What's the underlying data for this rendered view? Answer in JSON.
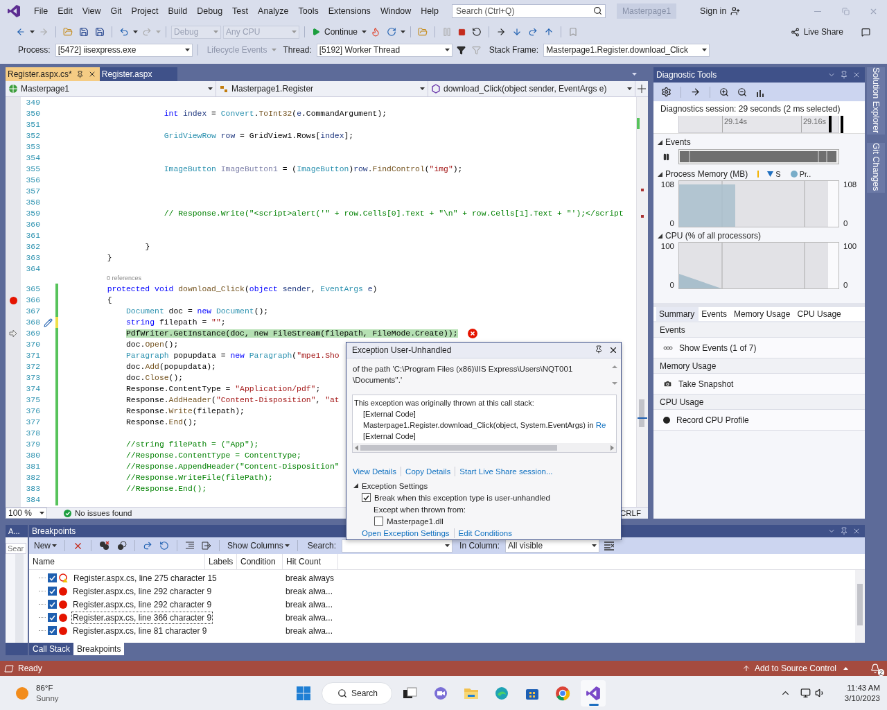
{
  "menu": {
    "items": [
      "File",
      "Edit",
      "View",
      "Git",
      "Project",
      "Build",
      "Debug",
      "Test",
      "Analyze",
      "Tools",
      "Extensions",
      "Window",
      "Help"
    ],
    "search": {
      "placeholder": "Search (Ctrl+Q)"
    },
    "solution": "Masterpage1",
    "sign_in": "Sign in"
  },
  "toolbar": {
    "configuration": {
      "value": "Debug",
      "disabled": true
    },
    "platform": {
      "value": "Any CPU",
      "disabled": true
    },
    "continue": "Continue",
    "live_share": "Live Share"
  },
  "debug_location": {
    "process_label": "Process:",
    "process": "[5472] iisexpress.exe",
    "lifecycle": {
      "label": "Lifecycle Events",
      "disabled": true
    },
    "thread_label": "Thread:",
    "thread": "[5192] Worker Thread",
    "stack_frame_label": "Stack Frame:",
    "stack_frame": "Masterpage1.Register.download_Click"
  },
  "editor": {
    "tabs": [
      {
        "label": "Register.aspx.cs*",
        "selected": true
      },
      {
        "label": "Register.aspx",
        "selected": false
      }
    ],
    "nav": [
      "Masterpage1",
      "Masterpage1.Register",
      "download_Click(object sender, EventArgs e)"
    ],
    "lines": [
      {
        "number": "349"
      },
      {
        "number": "350",
        "segments": [
          {
            "kind": "keyword",
            "text": "                    int"
          },
          {
            "kind": "local",
            "text": " index"
          },
          {
            "kind": "plain",
            "text": " = "
          },
          {
            "kind": "type",
            "text": "Convert"
          },
          {
            "kind": "plain",
            "text": "."
          },
          {
            "kind": "method",
            "text": "ToInt32"
          },
          {
            "kind": "plain",
            "text": "("
          },
          {
            "kind": "local",
            "text": "e"
          },
          {
            "kind": "plain",
            "text": ".CommandArgument);"
          }
        ]
      },
      {
        "number": "351"
      },
      {
        "number": "352",
        "segments": [
          {
            "kind": "type",
            "text": "                    GridViewRow"
          },
          {
            "kind": "local",
            "text": " row"
          },
          {
            "kind": "plain",
            "text": " = GridView1.Rows["
          },
          {
            "kind": "local",
            "text": "index"
          },
          {
            "kind": "plain",
            "text": "];"
          }
        ]
      },
      {
        "number": "353"
      },
      {
        "number": "354"
      },
      {
        "number": "355",
        "segments": [
          {
            "kind": "type",
            "text": "                    ImageButton"
          },
          {
            "kind": "unused",
            "text": " ImageButton1"
          },
          {
            "kind": "plain",
            "text": " = ("
          },
          {
            "kind": "type",
            "text": "ImageButton"
          },
          {
            "kind": "plain",
            "text": ")"
          },
          {
            "kind": "local",
            "text": "row"
          },
          {
            "kind": "plain",
            "text": "."
          },
          {
            "kind": "method",
            "text": "FindControl"
          },
          {
            "kind": "plain",
            "text": "("
          },
          {
            "kind": "string",
            "text": "\"img\""
          },
          {
            "kind": "plain",
            "text": ");"
          }
        ]
      },
      {
        "number": "356"
      },
      {
        "number": "357"
      },
      {
        "number": "358"
      },
      {
        "number": "359",
        "segments": [
          {
            "kind": "comment",
            "text": "                    // Response.Write(\"<script>alert('\" + row.Cells[0].Text + \"\\n\" + row.Cells[1].Text + \"');</script"
          }
        ]
      },
      {
        "number": "360"
      },
      {
        "number": "361"
      },
      {
        "number": "362",
        "segments": [
          {
            "kind": "plain",
            "text": "                }"
          }
        ]
      },
      {
        "number": "363",
        "segments": [
          {
            "kind": "plain",
            "text": "        }"
          }
        ]
      },
      {
        "number": "364"
      },
      {
        "number": "365",
        "codelens": "0 references",
        "changed": true,
        "segments": [
          {
            "kind": "keyword",
            "text": "        protected"
          },
          {
            "kind": "keyword",
            "text": " void"
          },
          {
            "kind": "method",
            "text": " download_Click"
          },
          {
            "kind": "plain",
            "text": "("
          },
          {
            "kind": "keyword",
            "text": "object"
          },
          {
            "kind": "local",
            "text": " sender"
          },
          {
            "kind": "plain",
            "text": ", "
          },
          {
            "kind": "type",
            "text": "EventArgs"
          },
          {
            "kind": "local",
            "text": " e"
          },
          {
            "kind": "plain",
            "text": ")"
          }
        ]
      },
      {
        "number": "366",
        "breakpoint": true,
        "changed": true,
        "segments": [
          {
            "kind": "plain",
            "text": "        {"
          }
        ]
      },
      {
        "number": "367",
        "changed": true,
        "segments": [
          {
            "kind": "type",
            "text": "            Document"
          },
          {
            "kind": "plain",
            "text": " doc = "
          },
          {
            "kind": "keyword",
            "text": "new"
          },
          {
            "kind": "type",
            "text": " Document"
          },
          {
            "kind": "plain",
            "text": "();"
          }
        ]
      },
      {
        "number": "368",
        "edited": true,
        "changed": true,
        "unsaved": true,
        "segments": [
          {
            "kind": "keyword",
            "text": "            string"
          },
          {
            "kind": "plain",
            "text": " filepath = "
          },
          {
            "kind": "string",
            "text": "\"\""
          },
          {
            "kind": "plain",
            "text": ";"
          }
        ]
      },
      {
        "number": "369",
        "current": true,
        "changed": true,
        "segments": [
          {
            "kind": "plain",
            "text": "            PdfWriter.GetInstance(doc, new FileStream(filepath, FileMode.Create));"
          }
        ]
      },
      {
        "number": "370",
        "changed": true,
        "segments": [
          {
            "kind": "plain",
            "text": "            doc."
          },
          {
            "kind": "method",
            "text": "Open"
          },
          {
            "kind": "plain",
            "text": "();"
          }
        ]
      },
      {
        "number": "371",
        "changed": true,
        "segments": [
          {
            "kind": "type",
            "text": "            Paragraph"
          },
          {
            "kind": "plain",
            "text": " popupdata = "
          },
          {
            "kind": "keyword",
            "text": "new"
          },
          {
            "kind": "type",
            "text": " Paragraph"
          },
          {
            "kind": "plain",
            "text": "("
          },
          {
            "kind": "string",
            "text": "\"mpe1.Sho"
          }
        ]
      },
      {
        "number": "372",
        "changed": true,
        "segments": [
          {
            "kind": "plain",
            "text": "            doc."
          },
          {
            "kind": "method",
            "text": "Add"
          },
          {
            "kind": "plain",
            "text": "(popupdata);"
          }
        ]
      },
      {
        "number": "373",
        "changed": true,
        "segments": [
          {
            "kind": "plain",
            "text": "            doc."
          },
          {
            "kind": "method",
            "text": "Close"
          },
          {
            "kind": "plain",
            "text": "();"
          }
        ]
      },
      {
        "number": "374",
        "changed": true,
        "segments": [
          {
            "kind": "plain",
            "text": "            Response.ContentType = "
          },
          {
            "kind": "string",
            "text": "\"Application/pdf\""
          },
          {
            "kind": "plain",
            "text": ";"
          }
        ]
      },
      {
        "number": "375",
        "changed": true,
        "segments": [
          {
            "kind": "plain",
            "text": "            Response."
          },
          {
            "kind": "method",
            "text": "AddHeader"
          },
          {
            "kind": "plain",
            "text": "("
          },
          {
            "kind": "string",
            "text": "\"Content-Disposition\""
          },
          {
            "kind": "plain",
            "text": ", "
          },
          {
            "kind": "string",
            "text": "\"at"
          }
        ]
      },
      {
        "number": "376",
        "changed": true,
        "segments": [
          {
            "kind": "plain",
            "text": "            Response."
          },
          {
            "kind": "method",
            "text": "Write"
          },
          {
            "kind": "plain",
            "text": "(filepath);"
          }
        ]
      },
      {
        "number": "377",
        "changed": true,
        "segments": [
          {
            "kind": "plain",
            "text": "            Response."
          },
          {
            "kind": "method",
            "text": "End"
          },
          {
            "kind": "plain",
            "text": "();"
          }
        ]
      },
      {
        "number": "378",
        "changed": true
      },
      {
        "number": "379",
        "changed": true,
        "segments": [
          {
            "kind": "comment",
            "text": "            //string filePath = (\"App\");"
          }
        ]
      },
      {
        "number": "380",
        "changed": true,
        "segments": [
          {
            "kind": "comment",
            "text": "            //Response.ContentType = ContentType;"
          }
        ]
      },
      {
        "number": "381",
        "changed": true,
        "segments": [
          {
            "kind": "comment",
            "text": "            //Response.AppendHeader(\"Content-Disposition\""
          }
        ]
      },
      {
        "number": "382",
        "changed": true,
        "segments": [
          {
            "kind": "comment",
            "text": "            //Response.WriteFile(filePath);"
          }
        ]
      },
      {
        "number": "383",
        "changed": true,
        "segments": [
          {
            "kind": "comment",
            "text": "            //Response.End();"
          }
        ]
      },
      {
        "number": "384",
        "changed": true
      }
    ],
    "zoom": "100 %",
    "issues": "No issues found",
    "line_ending": "CRLF"
  },
  "exception": {
    "title": "Exception User-Unhandled",
    "message": [
      "of the path 'C:\\Program Files (x86)\\IIS Express\\Users\\NQT001",
      "\\Documents''.'"
    ],
    "stack_intro": "This exception was originally thrown at this call stack:",
    "stack": [
      {
        "text": "[External Code]"
      },
      {
        "text": "Masterpage1.Register.download_Click(object, System.EventArgs) in ",
        "link": "Re"
      },
      {
        "text": "[External Code]"
      }
    ],
    "links": [
      "View Details",
      "Copy Details",
      "Start Live Share session..."
    ],
    "settings": {
      "title": "Exception Settings",
      "expanded": true,
      "break_option": {
        "label": "Break when this exception type is user-unhandled",
        "checked": true
      },
      "except_label": "Except when thrown from:",
      "modules": [
        {
          "label": "Masterpage1.dll",
          "checked": false
        }
      ]
    },
    "footer_links": [
      "Open Exception Settings",
      "Edit Conditions"
    ]
  },
  "diagnostics": {
    "title": "Diagnostic Tools",
    "session": "Diagnostics session: 29 seconds (2 ms selected)",
    "ruler": [
      "29.14s",
      "29.16s"
    ],
    "events_track": {
      "title": "Events",
      "expanded": true
    },
    "memory": {
      "title": "Process Memory (MB)",
      "expanded": true,
      "legend": [
        "S",
        "Pr.."
      ],
      "left_ticks": [
        "108",
        "0"
      ],
      "right_ticks": [
        "108",
        "0"
      ]
    },
    "cpu": {
      "title": "CPU (% of all processors)",
      "expanded": true,
      "left_ticks": [
        "100",
        "0"
      ],
      "right_ticks": [
        "100",
        "0"
      ]
    },
    "tabs": [
      {
        "label": "Summary",
        "selected": true
      },
      {
        "label": "Events",
        "selected": false
      },
      {
        "label": "Memory Usage",
        "selected": false
      },
      {
        "label": "CPU Usage",
        "selected": false
      }
    ],
    "summary": [
      {
        "heading": "Events",
        "action": "Show Events (1 of 7)",
        "kind": "events"
      },
      {
        "heading": "Memory Usage",
        "action": "Take Snapshot",
        "kind": "snapshot"
      },
      {
        "heading": "CPU Usage",
        "action": "Record CPU Profile",
        "kind": "record"
      }
    ]
  },
  "side_tabs": [
    "Solution Explorer",
    "Git Changes"
  ],
  "left_panel": {
    "title": "A...",
    "search_placeholder": "Sear"
  },
  "breakpoints": {
    "title": "Breakpoints",
    "toolbar": {
      "new": "New",
      "show_columns": "Show Columns",
      "search_label": "Search:",
      "column_label": "In Column:",
      "column_value": "All visible"
    },
    "columns": [
      "Name",
      "Labels",
      "Condition",
      "Hit Count"
    ],
    "rows": [
      {
        "name": "Register.aspx.cs, line 275 character 15",
        "hit_count": "break always",
        "checked": true,
        "selected": false,
        "kind": "warning"
      },
      {
        "name": "Register.aspx.cs, line 292 character 9",
        "hit_count": "break alwa...",
        "checked": true,
        "selected": false,
        "kind": "normal"
      },
      {
        "name": "Register.aspx.cs, line 292 character 9",
        "hit_count": "break alwa...",
        "checked": true,
        "selected": false,
        "kind": "normal"
      },
      {
        "name": "Register.aspx.cs, line 366 character 9",
        "hit_count": "break alwa...",
        "checked": true,
        "selected": true,
        "kind": "normal"
      },
      {
        "name": "Register.aspx.cs, line 81 character 9",
        "hit_count": "break alwa...",
        "checked": true,
        "selected": false,
        "kind": "normal"
      }
    ]
  },
  "bottom_tabs": [
    {
      "label": "Call Stack",
      "selected": false
    },
    {
      "label": "Breakpoints",
      "selected": true
    }
  ],
  "status_bar": {
    "text": "Ready",
    "source_control": "Add to Source Control",
    "notifications": "2"
  },
  "taskbar": {
    "temperature": "86°F",
    "weather": "Sunny",
    "search": "Search",
    "time": "11:43 AM",
    "date": "3/10/2023"
  }
}
